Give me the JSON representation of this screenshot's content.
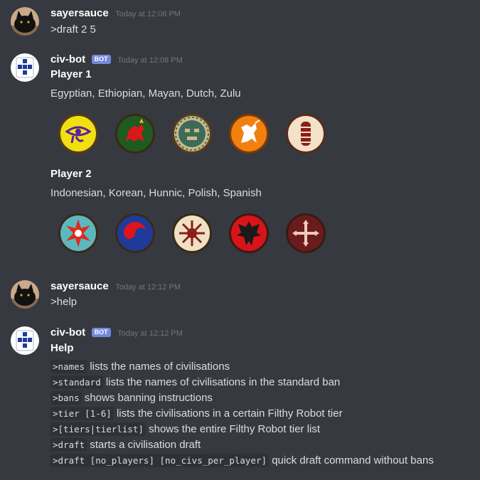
{
  "messages": [
    {
      "username": "sayersauce",
      "timestamp": "Today at 12:08 PM",
      "text": ">draft 2 5"
    },
    {
      "username": "civ-bot",
      "bot_tag": "BOT",
      "timestamp": "Today at 12:08 PM",
      "player1": {
        "title": "Player 1",
        "civs": "Egyptian, Ethiopian, Mayan, Dutch, Zulu"
      },
      "player2": {
        "title": "Player 2",
        "civs": "Indonesian, Korean, Hunnic, Polish, Spanish"
      }
    },
    {
      "username": "sayersauce",
      "timestamp": "Today at 12:12 PM",
      "text": ">help"
    },
    {
      "username": "civ-bot",
      "bot_tag": "BOT",
      "timestamp": "Today at 12:12 PM",
      "title": "Help",
      "commands": [
        {
          "code": ">names",
          "desc": "lists the names of civilisations"
        },
        {
          "code": ">standard",
          "desc": "lists the names of civilisations in the standard ban"
        },
        {
          "code": ">bans",
          "desc": "shows banning instructions"
        },
        {
          "code": ">tier [1-6]",
          "desc": "lists the civilisations in a certain Filthy Robot tier"
        },
        {
          "code": ">[tiers|tierlist]",
          "desc": "shows the entire Filthy Robot tier list"
        },
        {
          "code": ">draft",
          "desc": "starts a civilisation draft"
        },
        {
          "code": ">draft [no_players] [no_civs_per_player]",
          "desc": "quick draft command without bans"
        }
      ]
    }
  ],
  "icons": {
    "user_avatar": "black-cat-avatar",
    "bot_avatar": "blue-white-crest-avatar",
    "player1": [
      "egyptian-eye-emblem",
      "ethiopian-lion-emblem",
      "mayan-mask-emblem",
      "dutch-lion-emblem",
      "zulu-shield-emblem"
    ],
    "player2": [
      "indonesian-star-emblem",
      "korean-taeguk-emblem",
      "hunnic-sun-emblem",
      "polish-eagle-emblem",
      "spanish-cross-emblem"
    ]
  },
  "colors": {
    "background": "#36393f",
    "username": "#ffffff",
    "text": "#dcddde",
    "timestamp": "#72767d",
    "bot_tag": "#7289da",
    "code_bg": "#2f3136"
  }
}
